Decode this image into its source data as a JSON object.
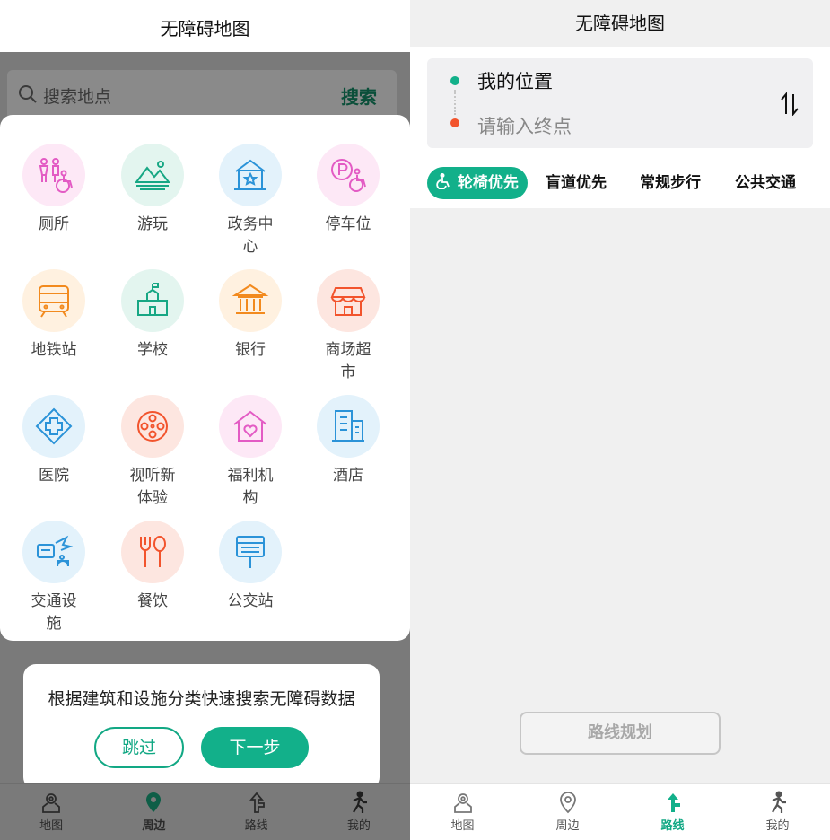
{
  "left": {
    "title": "无障碍地图",
    "search": {
      "placeholder": "搜索地点",
      "button": "搜索"
    },
    "categories": [
      {
        "label": "厕所",
        "icon": "restroom-icon",
        "color": "#e35bc4",
        "bg": "#fde8f6"
      },
      {
        "label": "游玩",
        "icon": "mountain-icon",
        "color": "#17a784",
        "bg": "#e3f5ef"
      },
      {
        "label": "政务中心",
        "icon": "government-icon",
        "color": "#2b93d8",
        "bg": "#e3f2fb"
      },
      {
        "label": "停车位",
        "icon": "parking-icon",
        "color": "#e35bc4",
        "bg": "#fde8f6"
      },
      {
        "label": "地铁站",
        "icon": "subway-icon",
        "color": "#f28a1e",
        "bg": "#fff1e0"
      },
      {
        "label": "学校",
        "icon": "school-icon",
        "color": "#17a784",
        "bg": "#e3f5ef"
      },
      {
        "label": "银行",
        "icon": "bank-icon",
        "color": "#f28a1e",
        "bg": "#fff1e0"
      },
      {
        "label": "商场超市",
        "icon": "shop-icon",
        "color": "#f2542d",
        "bg": "#fde6e0"
      },
      {
        "label": "医院",
        "icon": "hospital-icon",
        "color": "#2b93d8",
        "bg": "#e3f2fb"
      },
      {
        "label": "视听新体验",
        "icon": "film-reel-icon",
        "color": "#f2542d",
        "bg": "#fde6e0"
      },
      {
        "label": "福利机构",
        "icon": "welfare-home-icon",
        "color": "#e35bc4",
        "bg": "#fde8f6"
      },
      {
        "label": "酒店",
        "icon": "hotel-icon",
        "color": "#2b93d8",
        "bg": "#e3f2fb"
      },
      {
        "label": "交通设施",
        "icon": "transport-facility-icon",
        "color": "#2b93d8",
        "bg": "#e3f2fb"
      },
      {
        "label": "餐饮",
        "icon": "dining-icon",
        "color": "#f2542d",
        "bg": "#fde6e0"
      },
      {
        "label": "公交站",
        "icon": "bus-stop-icon",
        "color": "#2b93d8",
        "bg": "#e3f2fb"
      }
    ],
    "tip": {
      "text": "根据建筑和设施分类快速搜索无障碍数据",
      "skip": "跳过",
      "next": "下一步"
    },
    "tabs": [
      {
        "label": "地图",
        "icon": "map-icon"
      },
      {
        "label": "周边",
        "icon": "location-pin-icon"
      },
      {
        "label": "路线",
        "icon": "route-arrow-icon"
      },
      {
        "label": "我的",
        "icon": "walking-person-icon"
      }
    ]
  },
  "right": {
    "title": "无障碍地图",
    "route": {
      "from": "我的位置",
      "to_placeholder": "请输入终点"
    },
    "modes": [
      "轮椅优先",
      "盲道优先",
      "常规步行",
      "公共交通"
    ],
    "plan_button": "路线规划",
    "tabs": [
      {
        "label": "地图",
        "icon": "map-icon"
      },
      {
        "label": "周边",
        "icon": "location-pin-icon"
      },
      {
        "label": "路线",
        "icon": "route-arrow-icon"
      },
      {
        "label": "我的",
        "icon": "walking-person-icon"
      }
    ]
  },
  "colors": {
    "accent": "#12b08a",
    "end_point": "#f2542d"
  }
}
